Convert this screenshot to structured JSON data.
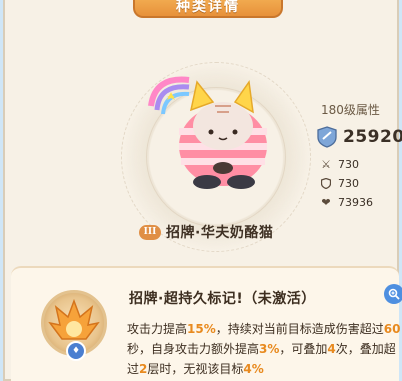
{
  "window": {
    "title": "种类详情"
  },
  "pet": {
    "level_label": "180级属性",
    "power": "25920",
    "stats": [
      {
        "icon": "swords-icon",
        "value": "730"
      },
      {
        "icon": "shield-icon",
        "value": "730"
      },
      {
        "icon": "heart-icon",
        "value": "73936"
      }
    ],
    "grade": "III",
    "name": "招牌·华夫奶酪猫"
  },
  "skill": {
    "title": "招牌·超持久标记!（未激活）",
    "badge": "♦",
    "desc_parts": [
      {
        "t": "攻击力提高",
        "h": false
      },
      {
        "t": "15%",
        "h": true
      },
      {
        "t": "，持续对当前目标造成伤害超过",
        "h": false
      },
      {
        "t": "60",
        "h": true
      },
      {
        "t": "秒，自身攻击力额外提高",
        "h": false
      },
      {
        "t": "3%",
        "h": true
      },
      {
        "t": "，可叠加",
        "h": false
      },
      {
        "t": "4",
        "h": true
      },
      {
        "t": "次，叠加超过",
        "h": false
      },
      {
        "t": "2",
        "h": true
      },
      {
        "t": "层时，无视该目标",
        "h": false
      },
      {
        "t": "4%",
        "h": true
      }
    ]
  },
  "colors": {
    "accent": "#e88a1f",
    "title_bar": "#eea24b",
    "zoom": "#4e8fe0"
  }
}
